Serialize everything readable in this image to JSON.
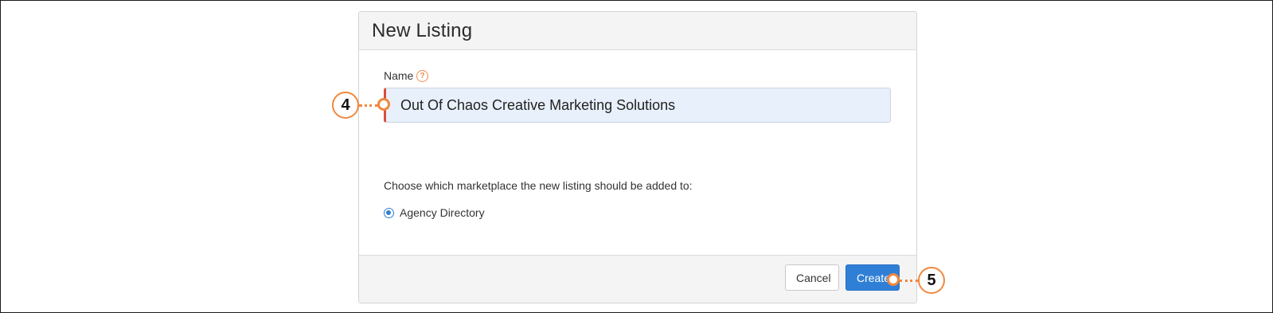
{
  "dialog": {
    "title": "New Listing",
    "name_label": "Name",
    "help_icon": "question-circle-icon",
    "name_value": "Out Of Chaos Creative Marketing Solutions",
    "marketplace_prompt": "Choose which marketplace the new listing should be added to:",
    "marketplace_option": "Agency Directory",
    "marketplace_selected": true,
    "cancel_label": "Cancel",
    "create_label": "Create"
  },
  "callouts": {
    "step_name": "4",
    "step_create": "5"
  },
  "colors": {
    "accent": "#2f7fd6",
    "callout": "#f0883e",
    "required_marker": "#d94c3a"
  }
}
